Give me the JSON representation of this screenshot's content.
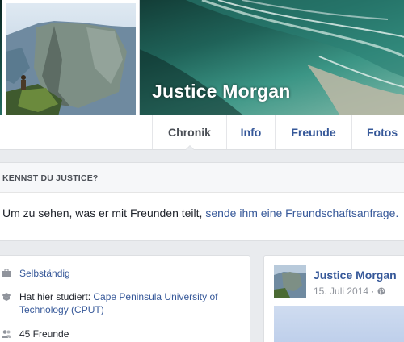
{
  "profile": {
    "name": "Justice Morgan"
  },
  "tabs": [
    {
      "label": "Chronik",
      "active": true
    },
    {
      "label": "Info",
      "active": false
    },
    {
      "label": "Freunde",
      "active": false
    },
    {
      "label": "Fotos",
      "active": false
    }
  ],
  "know_box": {
    "heading": "KENNST DU JUSTICE?",
    "text": "Um zu sehen, was er mit Freunden teilt, ",
    "link": "sende ihm eine Freundschaftsanfrage."
  },
  "intro": {
    "work": "Selbständig",
    "study_prefix": "Hat hier studiert: ",
    "study_link": "Cape Peninsula University of Technology (CPUT)",
    "friends": "45 Freunde",
    "icons": [
      "briefcase-icon",
      "graduation-cap-icon",
      "friends-icon"
    ]
  },
  "post": {
    "author": "Justice Morgan",
    "date": "15. Juli 2014 · ",
    "privacy_icon": "globe-icon"
  },
  "colors": {
    "link": "#365899",
    "background": "#e9ebee",
    "muted": "#90949c"
  }
}
